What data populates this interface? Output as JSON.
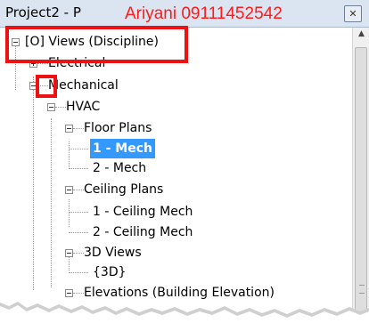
{
  "window": {
    "title": "Project2 - P",
    "watermark": "Ariyani 09111452542",
    "close_glyph": "✕"
  },
  "tree": {
    "root": "[O] Views (Discipline)",
    "electrical": "Electrical",
    "mechanical": "Mechanical",
    "hvac": "HVAC",
    "floor_plans": "Floor Plans",
    "floor_plan_1": "1 - Mech",
    "floor_plan_2": "2 - Mech",
    "ceiling_plans": "Ceiling Plans",
    "ceiling_plan_1": "1 - Ceiling Mech",
    "ceiling_plan_2": "2 - Ceiling Mech",
    "views_3d": "3D Views",
    "view_3d_default": "{3D}",
    "elevations": "Elevations (Building Elevation)"
  },
  "scrollbar": {
    "up_glyph": "▲"
  },
  "colors": {
    "selection": "#3399ff",
    "highlight_box": "#ee1111",
    "watermark": "#ff1a1a",
    "titlebar": "#dbe5f2"
  }
}
